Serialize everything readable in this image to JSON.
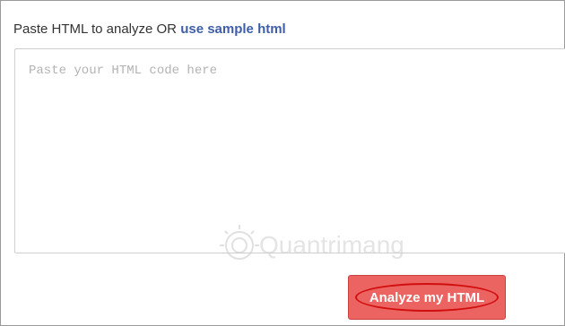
{
  "prompt": {
    "text": "Paste HTML to analyze OR ",
    "link_label": "use sample html"
  },
  "editor": {
    "placeholder": "Paste your HTML code here",
    "value": ""
  },
  "analyze_button": {
    "label": "Analyze my HTML"
  },
  "watermark": {
    "text": "Quantrimang",
    "icon": "lightbulb-icon"
  },
  "colors": {
    "link": "#3f5ea5",
    "button_bg": "#ec6461",
    "highlight_ring": "#d10f0f"
  }
}
